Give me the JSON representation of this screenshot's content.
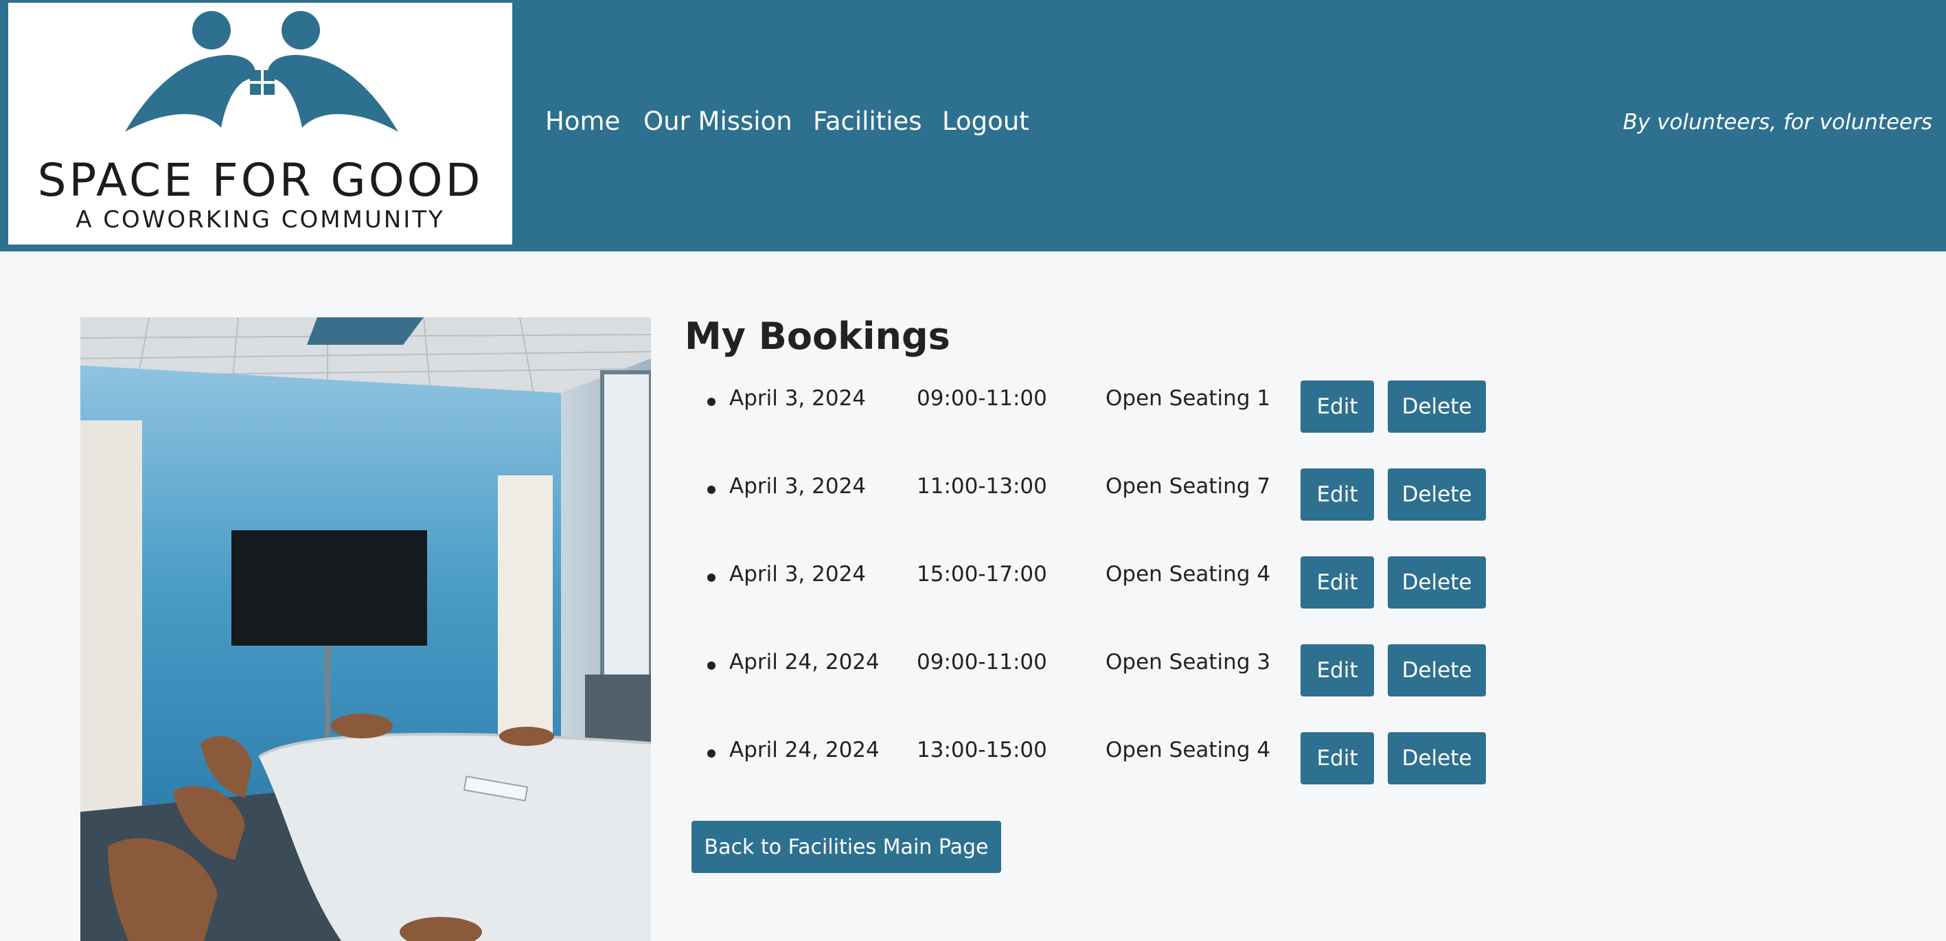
{
  "header": {
    "logo": {
      "title": "SPACE FOR GOOD",
      "subtitle": "A COWORKING COMMUNITY"
    },
    "nav": [
      {
        "label": "Home"
      },
      {
        "label": "Our Mission"
      },
      {
        "label": "Facilities"
      },
      {
        "label": "Logout"
      }
    ],
    "tagline": "By volunteers, for volunteers"
  },
  "main": {
    "heading": "My Bookings",
    "bookings": [
      {
        "date": "April 3, 2024",
        "time": "09:00-11:00",
        "space": "Open Seating 1",
        "edit_label": "Edit",
        "delete_label": "Delete"
      },
      {
        "date": "April 3, 2024",
        "time": "11:00-13:00",
        "space": "Open Seating 7",
        "edit_label": "Edit",
        "delete_label": "Delete"
      },
      {
        "date": "April 3, 2024",
        "time": "15:00-17:00",
        "space": "Open Seating 4",
        "edit_label": "Edit",
        "delete_label": "Delete"
      },
      {
        "date": "April 24, 2024",
        "time": "09:00-11:00",
        "space": "Open Seating 3",
        "edit_label": "Edit",
        "delete_label": "Delete"
      },
      {
        "date": "April 24, 2024",
        "time": "13:00-15:00",
        "space": "Open Seating 4",
        "edit_label": "Edit",
        "delete_label": "Delete"
      }
    ],
    "back_button": "Back to Facilities Main Page"
  },
  "colors": {
    "brand": "#2e708f",
    "page_background": "#f6f7f9",
    "text": "#222222"
  }
}
